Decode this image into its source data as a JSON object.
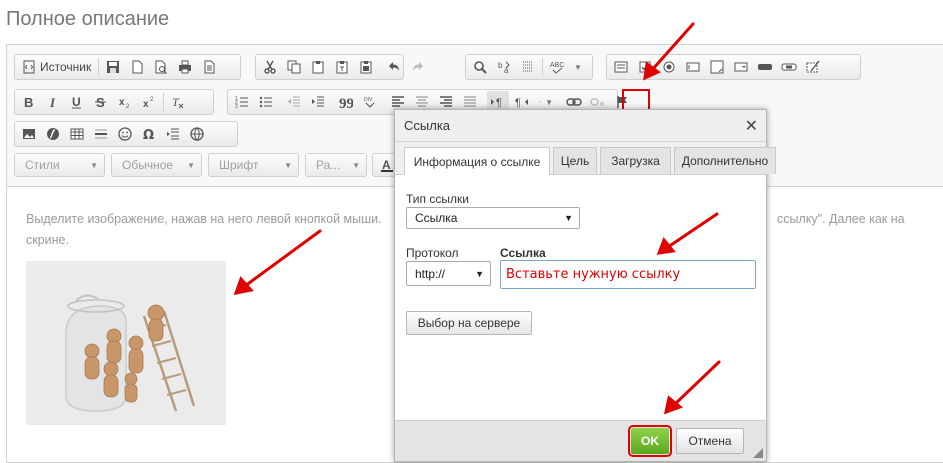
{
  "page": {
    "title": "Полное описание"
  },
  "toolbar": {
    "source_label": "Источник",
    "styles_label": "Стили",
    "format_label": "Обычное",
    "font_label": "Шрифт",
    "size_label": "Ра..."
  },
  "content": {
    "text_line1_left": "Выделите изображение, нажав на него левой кнопкой мыши.",
    "text_line1_right": "ссылку\". Далее как на",
    "text_line2": "скрине."
  },
  "dialog": {
    "title": "Ссылка",
    "tabs": [
      "Информация о ссылке",
      "Цель",
      "Загрузка",
      "Дополнительно"
    ],
    "link_type_label": "Тип ссылки",
    "link_type_value": "Ссылка",
    "protocol_label": "Протокол",
    "protocol_value": "http://",
    "url_label": "Ссылка",
    "url_value": "Вставьте нужную ссылку",
    "browse_server_label": "Выбор на сервере",
    "ok_label": "OK",
    "cancel_label": "Отмена"
  },
  "colors": {
    "highlight": "#e00000",
    "ok_button": "#6ab82c",
    "url_text": "#e00000"
  },
  "icons": [
    "source-icon",
    "save-icon",
    "new-page-icon",
    "preview-icon",
    "print-icon",
    "templates-icon",
    "cut-icon",
    "copy-icon",
    "paste-icon",
    "paste-text-icon",
    "paste-word-icon",
    "undo-icon",
    "redo-icon",
    "find-icon",
    "replace-icon",
    "select-all-icon",
    "spellcheck-icon",
    "form-icon",
    "checkbox-icon",
    "radio-icon",
    "textfield-icon",
    "textarea-icon",
    "select-field-icon",
    "button-icon",
    "image-button-icon",
    "hidden-field-icon",
    "bold-icon",
    "italic-icon",
    "underline-icon",
    "strike-icon",
    "subscript-icon",
    "superscript-icon",
    "remove-format-icon",
    "numbered-list-icon",
    "bulleted-list-icon",
    "outdent-icon",
    "indent-icon",
    "blockquote-icon",
    "div-icon",
    "align-left-icon",
    "align-center-icon",
    "align-right-icon",
    "justify-icon",
    "ltr-icon",
    "rtl-icon",
    "language-icon",
    "link-icon",
    "unlink-icon",
    "anchor-icon",
    "image-icon",
    "flash-icon",
    "table-icon",
    "hr-icon",
    "smiley-icon",
    "special-char-icon",
    "pagebreak-icon",
    "iframe-icon",
    "text-color-icon"
  ]
}
